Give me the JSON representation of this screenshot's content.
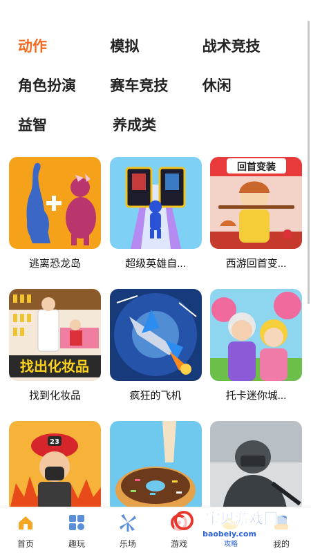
{
  "categories": [
    [
      {
        "label": "动作",
        "active": true
      },
      {
        "label": "模拟"
      },
      {
        "label": "战术竞技"
      }
    ],
    [
      {
        "label": "角色扮演"
      },
      {
        "label": "赛车竞技"
      },
      {
        "label": "休闲"
      }
    ],
    [
      {
        "label": "益智"
      },
      {
        "label": "养成类"
      }
    ]
  ],
  "games": [
    {
      "name": "逃离恐龙岛",
      "thumb_text": ""
    },
    {
      "name": "超级英雄自...",
      "thumb_text": ""
    },
    {
      "name": "西游回首变...",
      "thumb_text": "回首变装"
    },
    {
      "name": "找到化妆品",
      "thumb_text": "找出化妆品"
    },
    {
      "name": "疯狂的飞机",
      "thumb_text": ""
    },
    {
      "name": "托卡迷你城...",
      "thumb_text": ""
    },
    {
      "name": "",
      "thumb_text": "23"
    },
    {
      "name": "",
      "thumb_text": ""
    },
    {
      "name": "",
      "thumb_text": ""
    }
  ],
  "tabbar": [
    {
      "label": "首页",
      "icon": "home-icon"
    },
    {
      "label": "趣玩",
      "icon": "grid-icon"
    },
    {
      "label": "乐场",
      "icon": "windmill-icon"
    },
    {
      "label": "游戏",
      "icon": "gamepad-icon"
    },
    {
      "label": "",
      "icon": "cloud-icon"
    },
    {
      "label": "我的",
      "icon": "profile-icon"
    }
  ],
  "watermark": {
    "title": "宝贝游戏网",
    "url": "baobeiy.com",
    "sub": "攻略"
  },
  "colors": {
    "accent": "#f26b21",
    "text": "#222222",
    "icon_blue": "#5b8fd8"
  }
}
